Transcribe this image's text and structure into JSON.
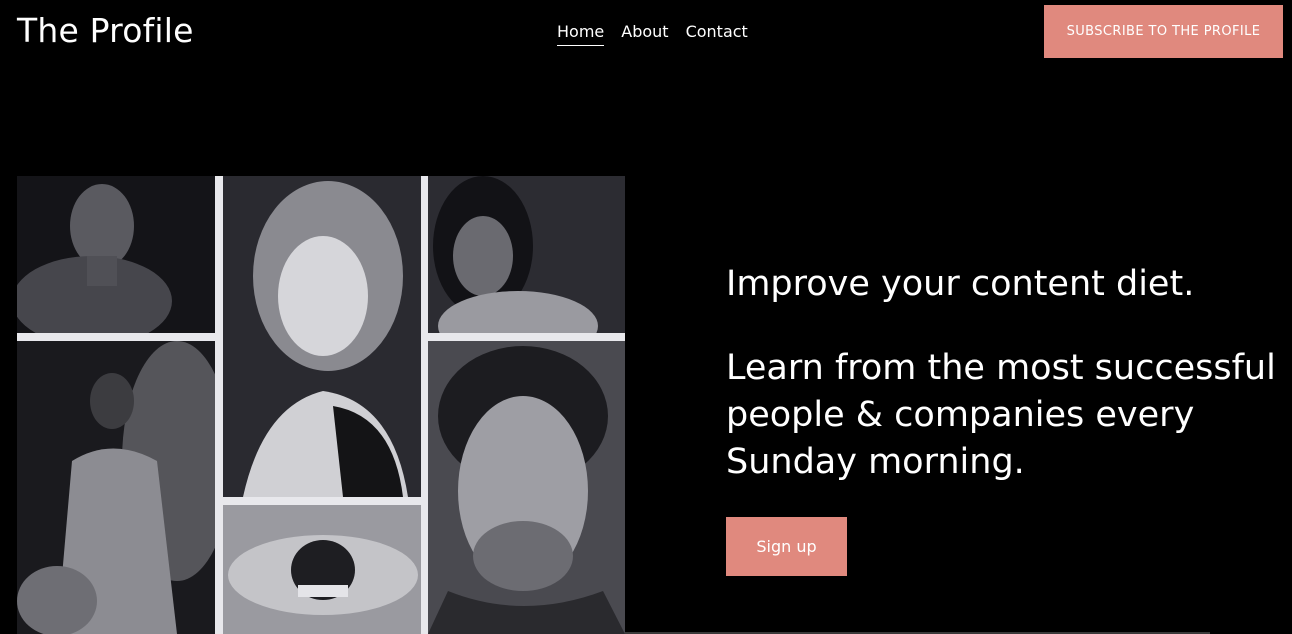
{
  "header": {
    "logo": "The Profile",
    "nav": [
      {
        "label": "Home",
        "active": true
      },
      {
        "label": "About",
        "active": false
      },
      {
        "label": "Contact",
        "active": false
      }
    ],
    "subscribe_label": "SUBSCRIBE TO THE PROFILE"
  },
  "hero": {
    "headline": "Improve your content diet.",
    "subline": "Learn from the most successful people & companies every Sunday morning.",
    "signup_label": "Sign up"
  },
  "colors": {
    "accent": "#e0897e",
    "background": "#000000",
    "text": "#ffffff"
  }
}
